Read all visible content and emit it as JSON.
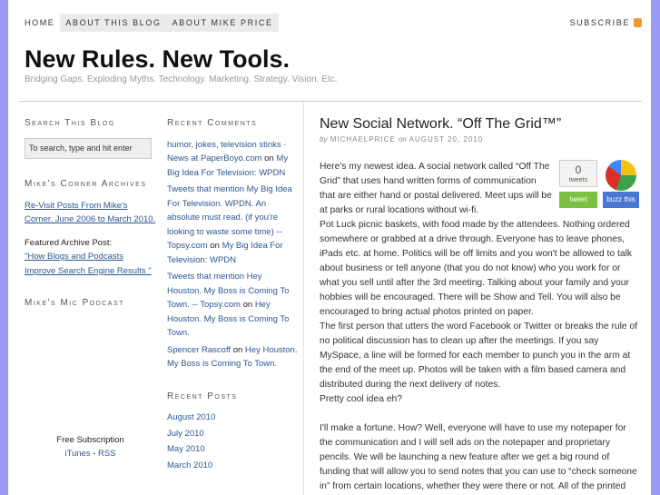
{
  "nav": {
    "home": "HOME",
    "about_blog": "ABOUT THIS BLOG",
    "about_mike": "ABOUT MIKE PRICE",
    "subscribe": "SUBSCRIBE"
  },
  "header": {
    "title": "New Rules. New Tools.",
    "tagline": "Bridging Gaps. Exploding Myths. Technology. Marketing. Strategy. Vision. Etc."
  },
  "left": {
    "search_heading": "Search This Blog",
    "search_placeholder": "To search, type and hit enter",
    "archives_heading": "Mike's Corner Archives",
    "archives_link": "Re-Visit Posts From Mike's Corner. June 2006 to March 2010.",
    "featured_label": "Featured Archive Post:",
    "featured_link": "\"How Blogs and Podcasts Improve Search Engine Results \"",
    "podcast_heading": "Mike's Mic Podcast",
    "free_sub": "Free Subscription",
    "itunes": "iTunes",
    "sep": " - ",
    "rss": "RSS"
  },
  "comments": {
    "heading": "Recent Comments",
    "items": [
      {
        "author": "humor, jokes, television stinks · News at PaperBoyo.com",
        "on": " on ",
        "post": "My Big Idea For Television: WPDN"
      },
      {
        "author": "Tweets that mention My Big Idea For Television. WPDN. An absolute must read. (if you're looking to waste some time) -- Topsy.com",
        "on": " on ",
        "post": "My Big Idea For Television: WPDN"
      },
      {
        "author": "Tweets that mention Hey Houston. My Boss is Coming To Town. -- Topsy.com",
        "on": " on ",
        "post": "Hey Houston. My Boss is Coming To Town."
      },
      {
        "author": "Spencer Rascoff",
        "on": " on ",
        "post": "Hey Houston. My Boss is Coming To Town."
      }
    ]
  },
  "recent_posts": {
    "heading": "Recent Posts",
    "items": [
      "August 2010",
      "July 2010",
      "May 2010",
      "March 2010"
    ]
  },
  "post": {
    "title": "New Social Network. “Off The Grid™”",
    "by": "by",
    "author": "MICHAELPRICE",
    "on": "on",
    "date": "AUGUST 20, 2010",
    "tweet_count": "0",
    "tweets_label": "tweets",
    "tweet_btn": "tweet",
    "buzz_btn": "buzz this",
    "paragraphs": [
      "Here's my newest idea. A social network called “Off The Grid” that uses hand written forms of communication that are either hand or postal delivered. Meet ups will be at parks or rural locations without wi-fi.",
      "Pot Luck picnic baskets, with food made by the attendees. Nothing ordered somewhere or grabbed at a drive through. Everyone has to leave phones, iPads etc. at home. Politics will be off limits and you won't be allowed to talk about business or tell anyone (that you do not know) who you work for or what you sell until after the 3rd meeting. Talking about your family and your hobbies will be encouraged. There will be Show and Tell. You will also be encouraged to bring actual photos printed on paper.",
      "The first person that utters the word Facebook or Twitter or breaks the rule of no political discussion has to clean up after the meetings. If you say MySpace, a line will be formed for each member to punch you in the arm at the end of the meet up. Photos will be taken with a film based camera and distributed during the next delivery of notes.",
      "Pretty cool idea eh?",
      "I'll make a fortune. How? Well, everyone will have to use my notepaper for the communication and I will sell ads on the notepaper and proprietary pencils. We will be launching a new feature after we get a big round of funding that will allow you to send notes that you can use to “check someone in” from certain locations, whether they were there or not. All of the printed"
    ]
  }
}
